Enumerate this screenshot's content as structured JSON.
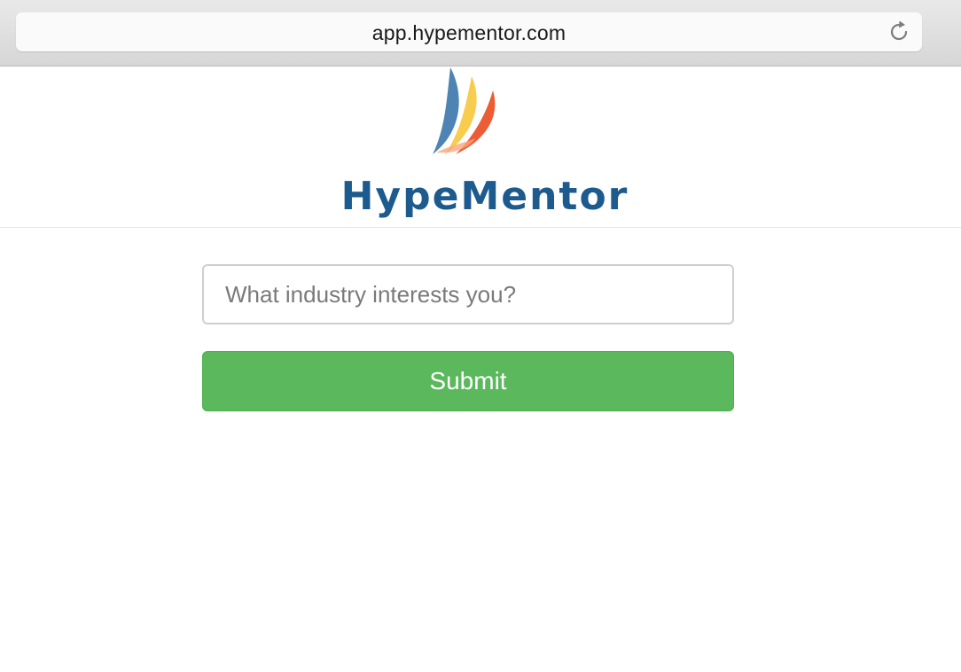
{
  "browser": {
    "url": "app.hypementor.com",
    "reload_icon": "reload-icon"
  },
  "brand": {
    "name": "HypeMentor",
    "logo_icon": "sail-logo-icon",
    "color": "#1d5a8e"
  },
  "form": {
    "industry_placeholder": "What industry interests you?",
    "industry_value": "",
    "submit_label": "Submit",
    "submit_color": "#5cb85c"
  }
}
